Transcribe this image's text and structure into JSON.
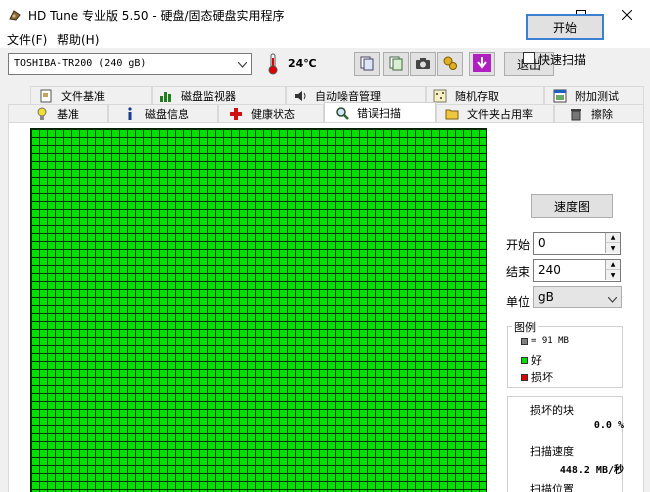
{
  "window": {
    "title": "HD Tune 专业版 5.50 - 硬盘/固态硬盘实用程序"
  },
  "menu": {
    "file": "文件(F)",
    "help": "帮助(H)"
  },
  "toolbar": {
    "drive": "TOSHIBA-TR200 (240 gB)",
    "temperature": "24℃",
    "exit_label": "退出"
  },
  "tabs_row1": [
    {
      "label": "文件基准",
      "icon": "document-icon"
    },
    {
      "label": "磁盘监视器",
      "icon": "chart-icon"
    },
    {
      "label": "自动噪音管理",
      "icon": "speaker-icon"
    },
    {
      "label": "随机存取",
      "icon": "random-icon"
    },
    {
      "label": "附加测试",
      "icon": "window-icon"
    }
  ],
  "tabs_row2": [
    {
      "label": "基准",
      "icon": "bulb-icon"
    },
    {
      "label": "磁盘信息",
      "icon": "info-icon"
    },
    {
      "label": "健康状态",
      "icon": "health-cross-icon"
    },
    {
      "label": "错误扫描",
      "icon": "magnifier-icon",
      "active": true
    },
    {
      "label": "文件夹占用率",
      "icon": "folder-icon"
    },
    {
      "label": "擦除",
      "icon": "trash-icon"
    }
  ],
  "scan": {
    "start_label": "开始",
    "quick_scan_label": "快速扫描",
    "quick_scan_checked": false,
    "speed_map_label": "速度图",
    "start_field_label": "开始",
    "start_value": "0",
    "end_field_label": "结束",
    "end_value": "240",
    "unit_field_label": "单位",
    "unit_value": "gB"
  },
  "legend": {
    "title": "图例",
    "block_size": "= 91 MB",
    "good": "好",
    "damaged": "损坏",
    "colors": {
      "block": "#808080",
      "good": "#00e000",
      "damaged": "#e00000"
    }
  },
  "stats": {
    "damaged_label": "损坏的块",
    "damaged_value": "0.0 %",
    "speed_label": "扫描速度",
    "speed_value": "448.2 MB/秒",
    "position_label": "扫描位置"
  }
}
